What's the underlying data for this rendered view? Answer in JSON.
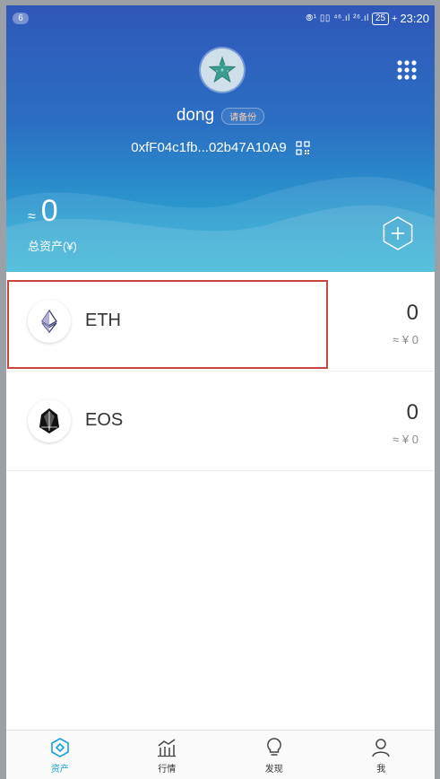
{
  "status_bar": {
    "notification_count": "6",
    "indicators": "⦾¹ ▯▯ ⁴⁶.ıl ²⁶.ıl",
    "battery": "25",
    "time": "23:20"
  },
  "wallet": {
    "name": "dong",
    "backup_label": "请备份",
    "address": "0xfF04c1fb...02b47A10A9"
  },
  "total_assets": {
    "approx_symbol": "≈",
    "value": "0",
    "label": "总资产(¥)"
  },
  "tokens": [
    {
      "symbol": "ETH",
      "amount": "0",
      "fiat": "≈ ¥ 0"
    },
    {
      "symbol": "EOS",
      "amount": "0",
      "fiat": "≈ ¥ 0"
    }
  ],
  "nav": [
    {
      "label": "资产",
      "icon": "assets-icon",
      "active": true
    },
    {
      "label": "行情",
      "icon": "market-chart-icon",
      "active": false
    },
    {
      "label": "发现",
      "icon": "lightbulb-icon",
      "active": false
    },
    {
      "label": "我",
      "icon": "user-icon",
      "active": false
    }
  ],
  "colors": {
    "header_top": "#2f57b9",
    "header_bottom": "#2bb1d4",
    "active_nav": "#1aa0d8",
    "highlight": "#c8463d"
  }
}
